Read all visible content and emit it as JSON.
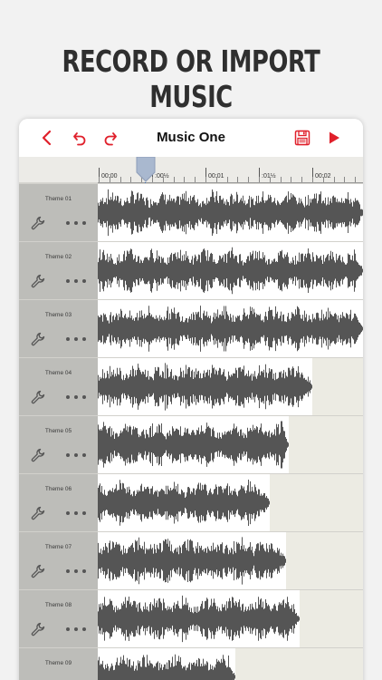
{
  "headline": "RECORD OR IMPORT MUSIC",
  "toolbar": {
    "title": "Music One",
    "back_icon": "chevron-left-icon",
    "undo_icon": "undo-icon",
    "redo_icon": "redo-icon",
    "save_icon": "floppy-disk-icon",
    "play_icon": "play-icon",
    "accent_color": "#e0202b"
  },
  "ruler": {
    "labels": [
      "00:00",
      ":00½",
      "00:01",
      ":01½",
      "00:02"
    ]
  },
  "tracks": [
    {
      "name": "Theme 01",
      "clip_length": 1.0
    },
    {
      "name": "Theme 02",
      "clip_length": 1.0
    },
    {
      "name": "Theme 03",
      "clip_length": 1.0
    },
    {
      "name": "Theme 04",
      "clip_length": 0.81
    },
    {
      "name": "Theme 05",
      "clip_length": 0.72
    },
    {
      "name": "Theme 06",
      "clip_length": 0.65
    },
    {
      "name": "Theme 07",
      "clip_length": 0.71
    },
    {
      "name": "Theme 08",
      "clip_length": 0.76
    },
    {
      "name": "Theme 09",
      "clip_length": 0.52
    }
  ],
  "colors": {
    "waveform": "#555555",
    "playhead": "#3c6fb0",
    "track_header": "#bdbdb9"
  }
}
